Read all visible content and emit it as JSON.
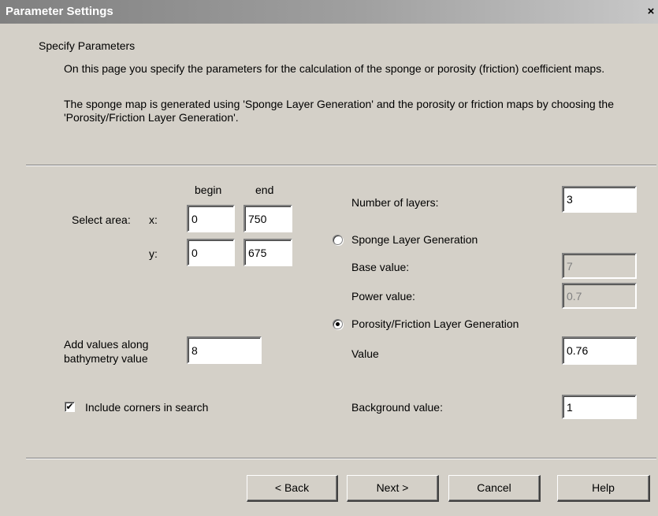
{
  "window": {
    "title": "Parameter Settings",
    "close_glyph": "×"
  },
  "header": {
    "title": "Specify Parameters",
    "description_1": "On this page you specify the parameters for the calculation of the sponge or porosity (friction) coefficient maps.",
    "description_2": "The sponge map is generated using 'Sponge Layer Generation' and the porosity or friction maps by choosing the 'Porosity/Friction Layer Generation'."
  },
  "area": {
    "col_begin": "begin",
    "col_end": "end",
    "select_label": "Select area:",
    "x_label": "x:",
    "y_label": "y:",
    "x_begin": "0",
    "x_end": "750",
    "y_begin": "0",
    "y_end": "675"
  },
  "bathymetry": {
    "label_line1": "Add values along",
    "label_line2": "bathymetry value",
    "value": "8"
  },
  "corners": {
    "label": "Include corners in search",
    "checked": true,
    "check_glyph": "✔"
  },
  "layers": {
    "number_label": "Number of layers:",
    "number_value": "3"
  },
  "sponge": {
    "radio_label": "Sponge Layer Generation",
    "selected": false,
    "base_label": "Base value:",
    "base_value": "7",
    "power_label": "Power value:",
    "power_value": "0.7"
  },
  "porosity": {
    "radio_label": "Porosity/Friction Layer Generation",
    "selected": true,
    "value_label": "Value",
    "value": "0.76"
  },
  "background": {
    "label": "Background value:",
    "value": "1"
  },
  "buttons": {
    "back": "< Back",
    "next": "Next >",
    "cancel": "Cancel",
    "help": "Help"
  }
}
